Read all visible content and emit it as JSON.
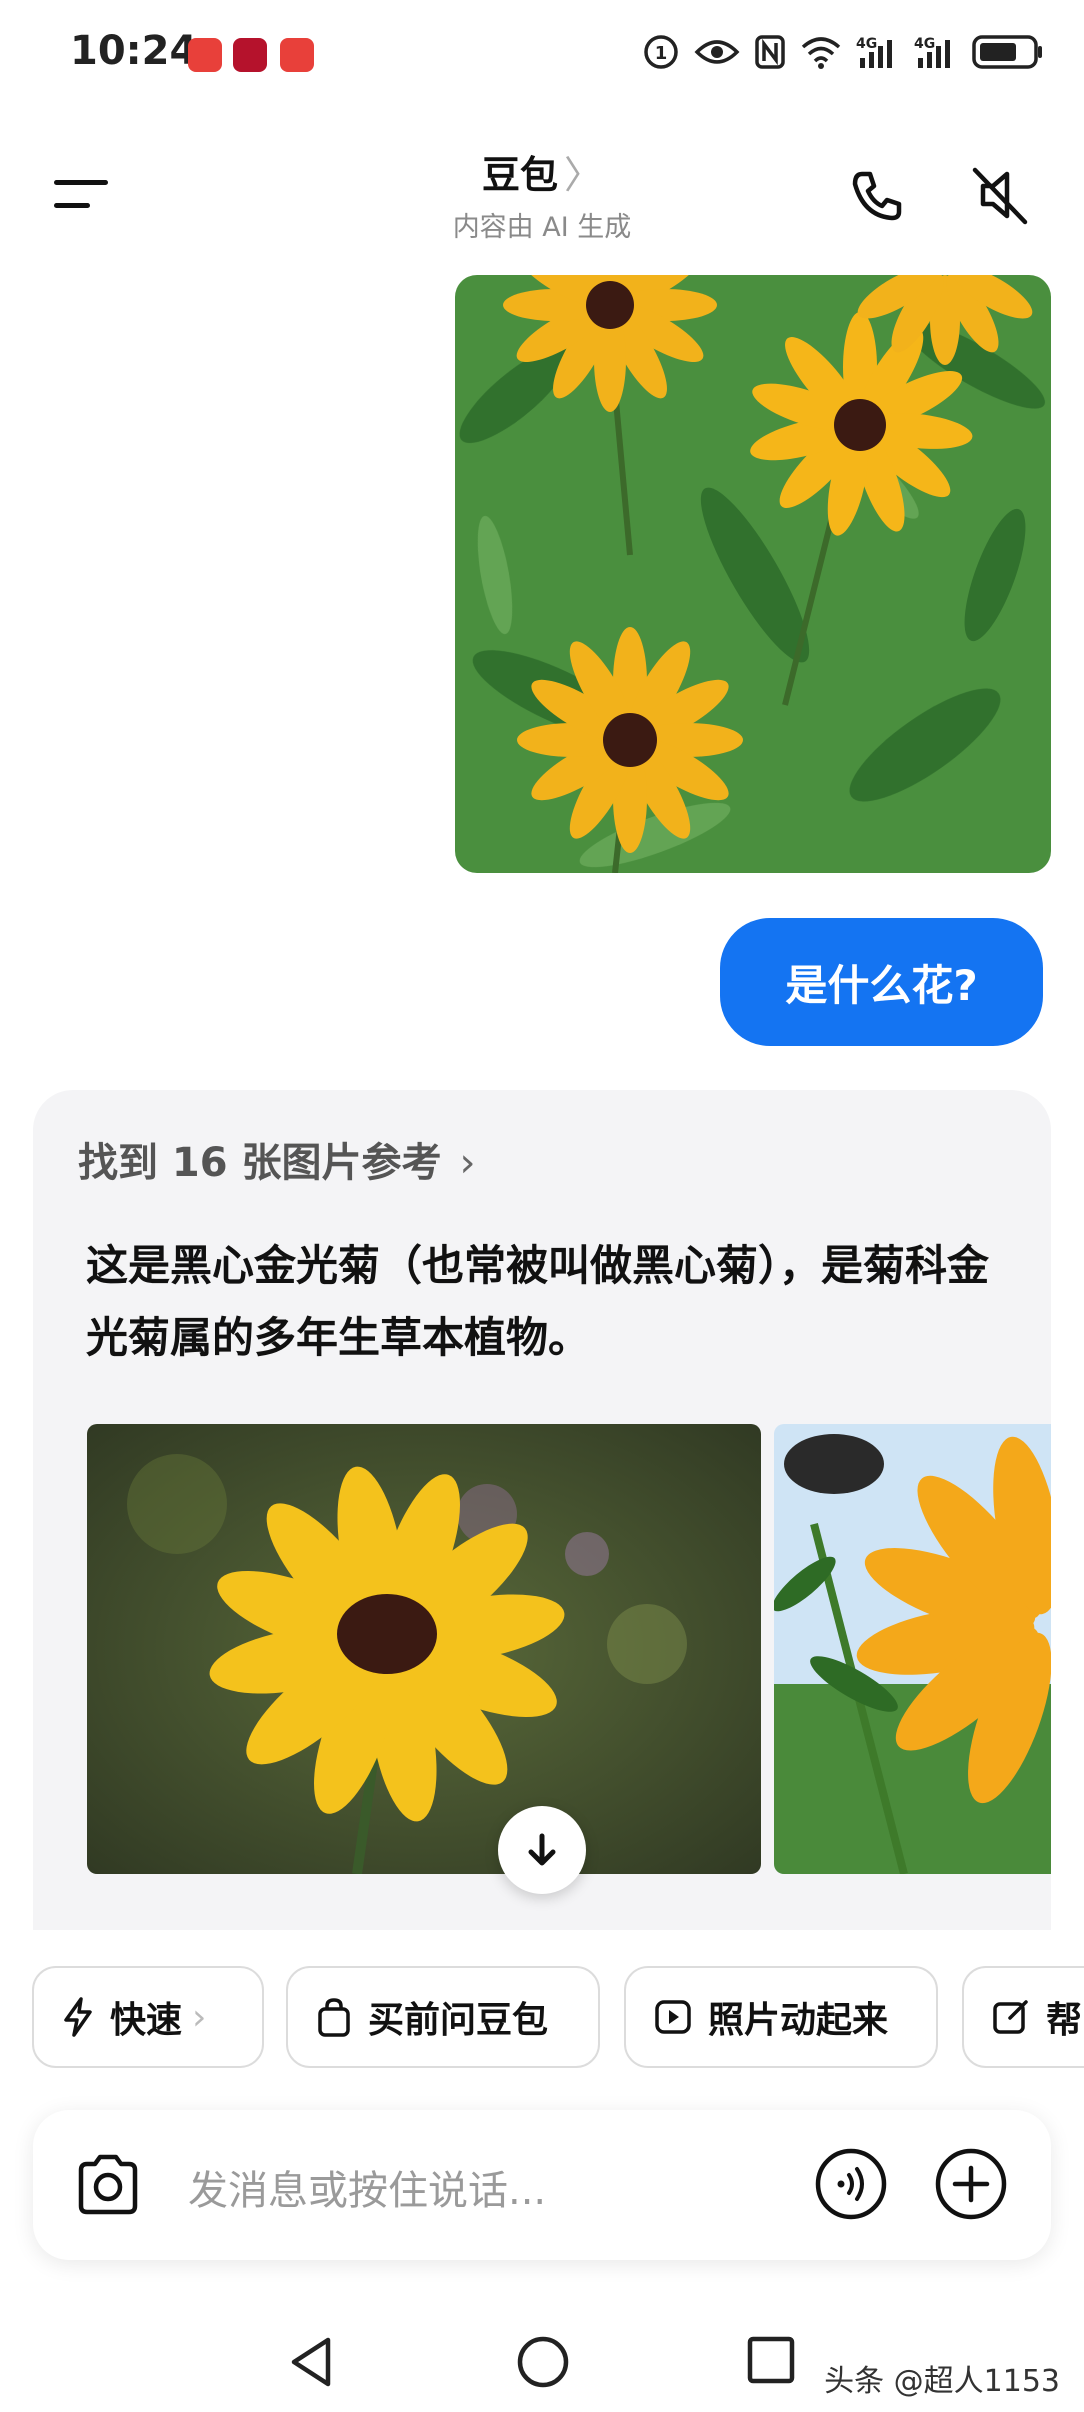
{
  "status_bar": {
    "time": "10:24",
    "network_1": "4G",
    "network_2": "4G",
    "notif_colors": [
      "#e8403a",
      "#c8102e",
      "#e8403a"
    ]
  },
  "header": {
    "title": "豆包",
    "title_chevron": "〉",
    "subtitle": "内容由 AI 生成"
  },
  "chat": {
    "user_message": "是什么花?",
    "reference_header": "找到 16 张图片参考",
    "reference_arrow": "›",
    "answer_prefix": "这是",
    "answer_bold": "黑心金光菊",
    "answer_rest": "（也常被叫做黑心菊），是菊科金光菊属的多年生草本植物。"
  },
  "chips": [
    {
      "label": "快速",
      "icon": "bolt-icon",
      "chevron": "›"
    },
    {
      "label": "买前问豆包",
      "icon": "bag-icon"
    },
    {
      "label": "照片动起来",
      "icon": "play-icon"
    },
    {
      "label": "帮",
      "icon": "edit-icon"
    }
  ],
  "input": {
    "placeholder": "发消息或按住说话..."
  },
  "watermark": "头条 @超人1153",
  "colors": {
    "accent": "#1474f2",
    "petal": "#f2b21b",
    "center": "#3b1a12",
    "foliage": "#3f8a3a"
  }
}
